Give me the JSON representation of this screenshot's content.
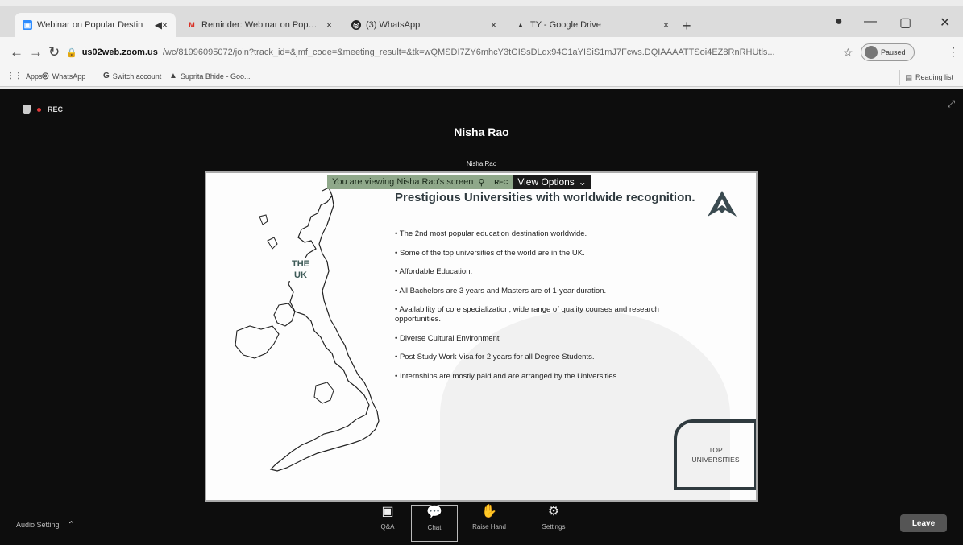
{
  "browser": {
    "tabs": [
      {
        "label": "Webinar on Popular Destin",
        "favicon": "zoom-icon",
        "extra": "◀×"
      },
      {
        "label": "Reminder: Webinar on Popular E",
        "favicon": "gmail-icon",
        "extra": "×"
      },
      {
        "label": "(3) WhatsApp",
        "favicon": "whatsapp-icon",
        "extra": "×"
      },
      {
        "label": "TY - Google Drive",
        "favicon": "drive-icon",
        "extra": "×"
      }
    ],
    "new_tab": "+",
    "url_host": "us02web.zoom.us",
    "url_path": "/wc/81996095072/join?track_id=&jmf_code=&meeting_result=&tk=wQMSDI7ZY6mhcY3tGISsDLdx94C1aYISiS1mJ7Fcws.DQIAAAATTSoi4EZ8RnRHUtls...",
    "paused_label": "Paused",
    "bookmarks": [
      {
        "label": "Apps",
        "icon": "apps-grid-icon"
      },
      {
        "label": "WhatsApp",
        "icon": "whatsapp-icon"
      },
      {
        "label": "Switch account",
        "icon": "google-icon"
      },
      {
        "label": "Suprita Bhide - Goo...",
        "icon": "drive-icon"
      }
    ],
    "reading_list": "Reading list"
  },
  "zoom": {
    "rec_label": "REC",
    "speaker": "Nisha Rao",
    "sharer_label": "Nisha Rao",
    "viewing_msg": "You are viewing Nisha Rao's screen",
    "viewing_rec": "REC",
    "view_options": "View Options",
    "audio_settings": "Audio Setting",
    "controls": [
      {
        "label": "Q&A",
        "icon": "qa-icon",
        "glyph": "▣"
      },
      {
        "label": "Chat",
        "icon": "chat-icon",
        "glyph": "💬"
      },
      {
        "label": "Raise Hand",
        "icon": "raise-hand-icon",
        "glyph": "✋"
      },
      {
        "label": "Settings",
        "icon": "settings-icon",
        "glyph": "⚙"
      }
    ],
    "leave": "Leave"
  },
  "slide": {
    "title": "Prestigious Universities with worldwide recognition.",
    "map_label_line1": "THE",
    "map_label_line2": "UK",
    "bullets": [
      "The 2nd most popular education destination worldwide.",
      "Some of the top universities of the world are in the UK.",
      "Affordable Education.",
      "All Bachelors are 3 years and Masters are of 1-year duration.",
      "Availability of core specialization, wide range of quality courses and research opportunities.",
      "Diverse Cultural Environment",
      "Post Study Work Visa for 2 years for all Degree Students.",
      "Internships are mostly paid and are arranged by the Universities"
    ],
    "badge_line1": "TOP",
    "badge_line2": "UNIVERSITIES"
  }
}
